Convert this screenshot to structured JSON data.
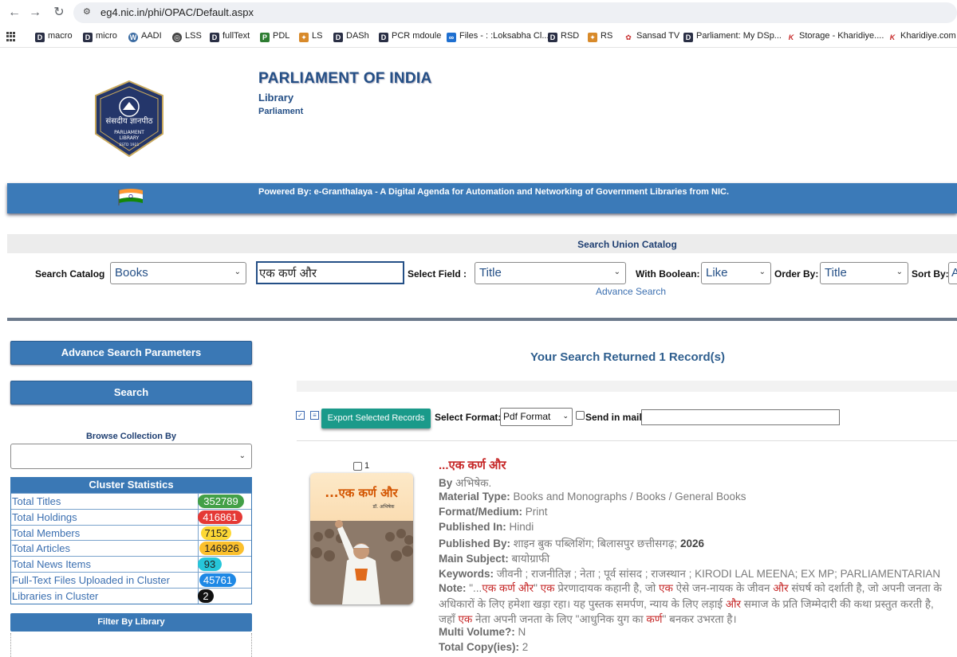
{
  "browser": {
    "url": "eg4.nic.in/phi/OPAC/Default.aspx",
    "bookmarks": [
      "macro",
      "micro",
      "AADI",
      "LSS",
      "fullText",
      "PDL",
      "LS",
      "DASh",
      "PCR mdoule",
      "Files - : :Loksabha Cl...",
      "RSD",
      "RS",
      "Sansad TV",
      "Parliament: My DSp...",
      "Storage - Kharidiye....",
      "Kharidiye.com"
    ]
  },
  "header": {
    "title": "PARLIAMENT OF INDIA",
    "sub1": "Library",
    "sub2": "Parliament",
    "logo_lines": [
      "संसदीय ज्ञानपीठ",
      "PARLIAMENT",
      "LIBRARY",
      "ESTD 1921"
    ],
    "banner": "Powered By: e-Granthalaya - A Digital Agenda for Automation and Networking of Government Libraries from NIC."
  },
  "search": {
    "heading": "Search Union Catalog",
    "catalog_label": "Search Catalog",
    "catalog_value": "Books",
    "query": "एक कर्ण और",
    "field_label": "Select Field :",
    "field_value": "Title",
    "boolean_label": "With Boolean:",
    "boolean_value": "Like",
    "order_label": "Order By:",
    "order_value": "Title",
    "sort_label": "Sort By:",
    "sort_value": "A",
    "advance_link": "Advance Search"
  },
  "left": {
    "adv_params": "Advance Search Parameters",
    "search_btn": "Search",
    "browse_label": "Browse Collection By",
    "cluster_title": "Cluster Statistics",
    "stats": [
      {
        "name": "Total Titles",
        "value": "352789",
        "color": "#43a047",
        "text": "#fff"
      },
      {
        "name": "Total Holdings",
        "value": "416861",
        "color": "#e53935",
        "text": "#fff"
      },
      {
        "name": "Total Members",
        "value": "7152",
        "color": "#fdd835",
        "text": "#222"
      },
      {
        "name": "Total Articles",
        "value": "146926",
        "color": "#fbc02d",
        "text": "#222"
      },
      {
        "name": "Total News Items",
        "value": "93",
        "color": "#26c6da",
        "text": "#222"
      },
      {
        "name": "Full-Text Files Uploaded in Cluster",
        "value": "45761",
        "color": "#1e88e5",
        "text": "#fff"
      },
      {
        "name": "Libraries in Cluster",
        "value": "2",
        "color": "#111111",
        "text": "#fff"
      }
    ],
    "filter_label": "Filter By Library"
  },
  "results": {
    "title": "Your Search Returned 1 Record(s)",
    "export_btn": "Export Selected Records",
    "format_label": "Select Format:",
    "format_value": "Pdf Format",
    "mail_label": "Send in mail",
    "record": {
      "number": "1",
      "title": "...एक कर्ण और",
      "cover_title": "...एक कर्ण और",
      "cover_author": "डॉ. अभिषेक",
      "by_label": "By",
      "by_value": "अभिषेक.",
      "material_label": "Material Type:",
      "material_value": "Books and Monographs / Books / General Books",
      "format_label": "Format/Medium:",
      "format_value": "Print",
      "published_in_label": "Published In:",
      "published_in_value": "Hindi",
      "published_by_label": "Published By:",
      "published_by_value": "शाइन बुक पब्लिशिंग; बिलासपुर छत्तीसगढ़;",
      "published_year": "2026",
      "subject_label": "Main Subject:",
      "subject_value": "बायोग्राफी",
      "keywords_label": "Keywords:",
      "keywords_value": "जीवनी ; राजनीतिज्ञ ; नेता ; पूर्व सांसद ; राजस्थान ; KIRODI LAL MEENA; EX MP; PARLIAMENTARIAN",
      "note_label": "Note:",
      "note_parts": [
        "\"...",
        "एक कर्ण और",
        "\" ",
        "एक",
        " प्रेरणादायक कहानी है, जो ",
        "एक",
        " ऐसे जन-नायक के जीवन ",
        "और",
        " संघर्ष को दर्शाती है, जो अपनी जनता के अधिकारों के लिए हमेशा खड़ा रहा। यह पुस्तक समर्पण, न्याय के लिए लड़ाई ",
        "और",
        " समाज के प्रति जिम्मेदारी की कथा प्रस्तुत करती है, जहाँ ",
        "एक",
        " नेता अपनी जनता के लिए \"आधुनिक युग का ",
        "कर्ण",
        "\" बनकर उभरता है।"
      ],
      "volume_label": "Multi Volume?:",
      "volume_value": "N",
      "copies_label": "Total Copy(ies):",
      "copies_value": "2"
    }
  }
}
